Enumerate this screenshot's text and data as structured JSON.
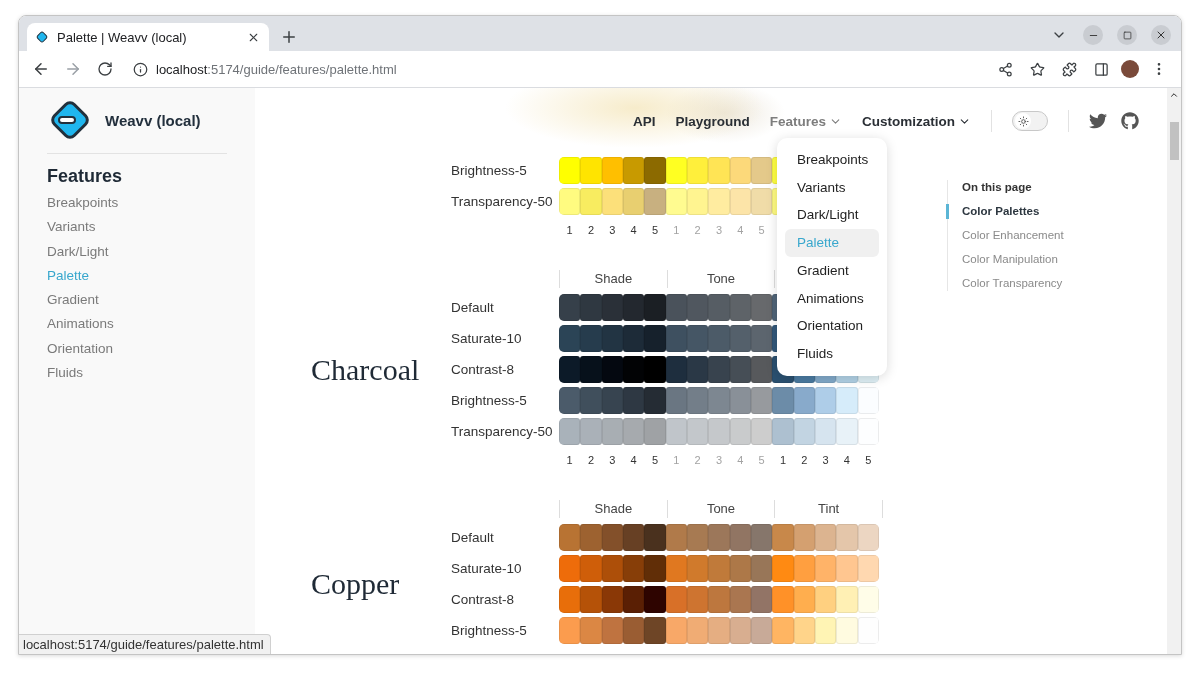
{
  "browser": {
    "tab_title": "Palette | Weavv (local)",
    "url_host": "localhost",
    "url_path": ":5174/guide/features/palette.html",
    "status_url": "localhost:5174/guide/features/palette.html"
  },
  "sidebar": {
    "site_title": "Weavv (local)",
    "heading": "Features",
    "items": [
      {
        "label": "Breakpoints",
        "selected": false
      },
      {
        "label": "Variants",
        "selected": false
      },
      {
        "label": "Dark/Light",
        "selected": false
      },
      {
        "label": "Palette",
        "selected": true
      },
      {
        "label": "Gradient",
        "selected": false
      },
      {
        "label": "Animations",
        "selected": false
      },
      {
        "label": "Orientation",
        "selected": false
      },
      {
        "label": "Fluids",
        "selected": false
      }
    ]
  },
  "nav": {
    "items": [
      {
        "label": "API",
        "kind": "link",
        "expanded": false
      },
      {
        "label": "Playground",
        "kind": "link",
        "expanded": false
      },
      {
        "label": "Features",
        "kind": "menu",
        "expanded": true
      },
      {
        "label": "Customization",
        "kind": "menu",
        "expanded": false
      }
    ],
    "dark_mode": false
  },
  "features_menu": {
    "items": [
      {
        "label": "Breakpoints",
        "selected": false
      },
      {
        "label": "Variants",
        "selected": false
      },
      {
        "label": "Dark/Light",
        "selected": false
      },
      {
        "label": "Palette",
        "selected": true
      },
      {
        "label": "Gradient",
        "selected": false
      },
      {
        "label": "Animations",
        "selected": false
      },
      {
        "label": "Orientation",
        "selected": false
      },
      {
        "label": "Fluids",
        "selected": false
      }
    ]
  },
  "toc": {
    "heading": "On this page",
    "items": [
      {
        "label": "Color Palettes",
        "selected": true
      },
      {
        "label": "Color Enhancement",
        "selected": false
      },
      {
        "label": "Color Manipulation",
        "selected": false
      },
      {
        "label": "Color Transparency",
        "selected": false
      }
    ]
  },
  "palettes": [
    {
      "rows": [
        {
          "label": "Brightness-5",
          "swatches": [
            {
              "color": "#ffff00"
            },
            {
              "color": "#ffe400"
            },
            {
              "color": "#ffbf00"
            },
            {
              "color": "#c89a00"
            },
            {
              "color": "#8c6a00"
            },
            {
              "color": "#ffff22"
            },
            {
              "color": "#ffef3b"
            },
            {
              "color": "#ffe455"
            },
            {
              "color": "#fcd97a"
            },
            {
              "color": "#e4c98a"
            },
            {
              "color": "#ffff40"
            }
          ]
        },
        {
          "label": "Transparency-50",
          "swatches": [
            {
              "color": "#fffb80"
            },
            {
              "color": "#f8ec60"
            },
            {
              "color": "#fce07a"
            },
            {
              "color": "#e8cf70"
            },
            {
              "color": "#c8b080"
            },
            {
              "color": "#fffb90"
            },
            {
              "color": "#fff490"
            },
            {
              "color": "#ffeca0"
            },
            {
              "color": "#fce4a8"
            },
            {
              "color": "#f0dca8"
            },
            {
              "color": "#fffb80"
            }
          ]
        }
      ],
      "numbers": [
        "1",
        "2",
        "3",
        "4",
        "5",
        "1",
        "2",
        "3",
        "4",
        "5"
      ]
    },
    {
      "name": "Charcoal",
      "groups": [
        "Shade",
        "Tone"
      ],
      "rows": [
        {
          "label": "Default",
          "swatches": [
            {
              "color": "#36404a"
            },
            {
              "color": "#2f3841"
            },
            {
              "color": "#2a3038"
            },
            {
              "color": "#23282f"
            },
            {
              "color": "#1b1f24"
            },
            {
              "color": "#4a525b"
            },
            {
              "color": "#50575f"
            },
            {
              "color": "#565d64"
            },
            {
              "color": "#5e6368"
            },
            {
              "color": "#67696c"
            },
            {
              "color": "#506478"
            }
          ]
        },
        {
          "label": "Saturate-10",
          "swatches": [
            {
              "color": "#2b4456"
            },
            {
              "color": "#263c4d"
            },
            {
              "color": "#223443"
            },
            {
              "color": "#1d2b38"
            },
            {
              "color": "#16212c"
            },
            {
              "color": "#3e5060"
            },
            {
              "color": "#455665"
            },
            {
              "color": "#4c5b68"
            },
            {
              "color": "#54606b"
            },
            {
              "color": "#5c656e"
            },
            {
              "color": "#32587a"
            }
          ]
        },
        {
          "label": "Contrast-8",
          "swatches": [
            {
              "color": "#0c1a28"
            },
            {
              "color": "#07111b"
            },
            {
              "color": "#040810"
            },
            {
              "color": "#020305"
            },
            {
              "color": "#000000"
            },
            {
              "color": "#1e2e3e"
            },
            {
              "color": "#2a3846"
            },
            {
              "color": "#38434e"
            },
            {
              "color": "#464e56"
            },
            {
              "color": "#57595c"
            },
            {
              "color": "#2a5070"
            },
            {
              "color": "#4a7aa0"
            },
            {
              "color": "#80a8c8"
            },
            {
              "color": "#b0d0e4"
            },
            {
              "color": "#ddeef4"
            }
          ]
        },
        {
          "label": "Brightness-5",
          "swatches": [
            {
              "color": "#4b5b6a"
            },
            {
              "color": "#404f5c"
            },
            {
              "color": "#374450"
            },
            {
              "color": "#2e3843"
            },
            {
              "color": "#252c34"
            },
            {
              "color": "#6a7682"
            },
            {
              "color": "#737e89"
            },
            {
              "color": "#7d8791"
            },
            {
              "color": "#899098"
            },
            {
              "color": "#979a9e"
            },
            {
              "color": "#6c8ca8"
            },
            {
              "color": "#88aacb"
            },
            {
              "color": "#aecde8"
            },
            {
              "color": "#d6ecfa"
            },
            {
              "color": "#fbfdff"
            }
          ]
        },
        {
          "label": "Transparency-50",
          "swatches": [
            {
              "color": "#a9b2ba"
            },
            {
              "color": "#aab1b8"
            },
            {
              "color": "#a8aeb3"
            },
            {
              "color": "#a6aaae"
            },
            {
              "color": "#9fa2a5"
            },
            {
              "color": "#c0c5ca"
            },
            {
              "color": "#c3c7cb"
            },
            {
              "color": "#c5c8cb"
            },
            {
              "color": "#c9cbcc"
            },
            {
              "color": "#cdcdcd"
            },
            {
              "color": "#adc0d0"
            },
            {
              "color": "#c2d4e2"
            },
            {
              "color": "#d6e4ef"
            },
            {
              "color": "#e8f2f8"
            },
            {
              "color": "#fdfeff"
            }
          ]
        }
      ],
      "numbers": [
        "1",
        "2",
        "3",
        "4",
        "5",
        "1",
        "2",
        "3",
        "4",
        "5",
        "1",
        "2",
        "3",
        "4",
        "5"
      ]
    },
    {
      "name": "Copper",
      "groups": [
        "Shade",
        "Tone",
        "Tint"
      ],
      "rows": [
        {
          "label": "Default",
          "swatches": [
            {
              "color": "#b87333"
            },
            {
              "color": "#9d6230"
            },
            {
              "color": "#83502a"
            },
            {
              "color": "#674024"
            },
            {
              "color": "#4a311e"
            },
            {
              "color": "#b07a4a"
            },
            {
              "color": "#a77a52"
            },
            {
              "color": "#9c775a"
            },
            {
              "color": "#917563"
            },
            {
              "color": "#86766b"
            },
            {
              "color": "#c8884a"
            },
            {
              "color": "#d4a070"
            },
            {
              "color": "#dcb490"
            },
            {
              "color": "#e4c6aa"
            },
            {
              "color": "#ecd6c2"
            }
          ]
        },
        {
          "label": "Saturate-10",
          "swatches": [
            {
              "color": "#ee6c0a"
            },
            {
              "color": "#cf5e09"
            },
            {
              "color": "#ad4f09"
            },
            {
              "color": "#873e08"
            },
            {
              "color": "#612e07"
            },
            {
              "color": "#e07820"
            },
            {
              "color": "#d07a2c"
            },
            {
              "color": "#c07a3a"
            },
            {
              "color": "#ad7848"
            },
            {
              "color": "#987658"
            },
            {
              "color": "#ff8a12"
            },
            {
              "color": "#ff9f40"
            },
            {
              "color": "#ffb368"
            },
            {
              "color": "#ffc690"
            },
            {
              "color": "#ffd8b0"
            }
          ]
        },
        {
          "label": "Contrast-8",
          "swatches": [
            {
              "color": "#e86e0a"
            },
            {
              "color": "#b55208"
            },
            {
              "color": "#8a3806"
            },
            {
              "color": "#5a1f04"
            },
            {
              "color": "#2e0400"
            },
            {
              "color": "#d87028"
            },
            {
              "color": "#ce7430"
            },
            {
              "color": "#bd773e"
            },
            {
              "color": "#aa7650"
            },
            {
              "color": "#927466"
            },
            {
              "color": "#ff9128"
            },
            {
              "color": "#ffae4e"
            },
            {
              "color": "#ffd080"
            },
            {
              "color": "#fff0b4"
            },
            {
              "color": "#fffde8"
            }
          ]
        },
        {
          "label": "Brightness-5",
          "swatches": [
            {
              "color": "#fb9c4e"
            },
            {
              "color": "#db8744"
            },
            {
              "color": "#bf7340"
            },
            {
              "color": "#9a5d33"
            },
            {
              "color": "#6e4526"
            },
            {
              "color": "#f8a868"
            },
            {
              "color": "#f0ac74"
            },
            {
              "color": "#e5ae82"
            },
            {
              "color": "#d8ae90"
            },
            {
              "color": "#c8aa98"
            },
            {
              "color": "#ffb562"
            },
            {
              "color": "#ffd48a"
            },
            {
              "color": "#fff4b4"
            },
            {
              "color": "#fffbe0"
            },
            {
              "color": "#fefefe"
            }
          ]
        }
      ]
    }
  ]
}
